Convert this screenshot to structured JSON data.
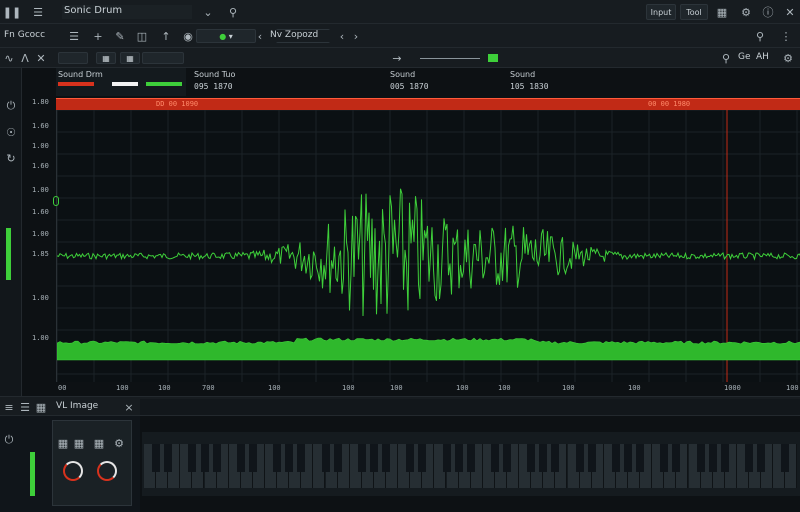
{
  "app": {
    "title": "Sonic Drum"
  },
  "titlebar": {
    "btn_a": "Input",
    "btn_b": "Tool"
  },
  "toolbar": {
    "project": "Fn Gcocc",
    "channel": "Nv Zopozd"
  },
  "panels": {
    "a": {
      "label": "Sound Drm",
      "value": ""
    },
    "b": {
      "label": "Sound Tuo",
      "value": "095 1870"
    },
    "c": {
      "label": "Sound",
      "value": "005 1870"
    },
    "d": {
      "label": "Sound",
      "value": "105 1830"
    }
  },
  "right_tools": {
    "a": "Ge",
    "b": "AH"
  },
  "timeline": {
    "marker_left": "DD 00 1090",
    "marker_right": "00 00 1980"
  },
  "y_ticks": [
    "1.80",
    "1.60",
    "1.00",
    "1.60",
    "1.00",
    "1.60",
    "1.00",
    "1.85",
    "1.00",
    "1.00"
  ],
  "x_ticks": [
    "00",
    "100",
    "100",
    "700",
    "100",
    "100",
    "100",
    "100",
    "100",
    "100",
    "100",
    "1000",
    "100"
  ],
  "bottom": {
    "tab_label": "VL Image"
  },
  "colors": {
    "accent": "#3ecf3a",
    "marker": "#d8321d",
    "bg": "#0d1114"
  }
}
